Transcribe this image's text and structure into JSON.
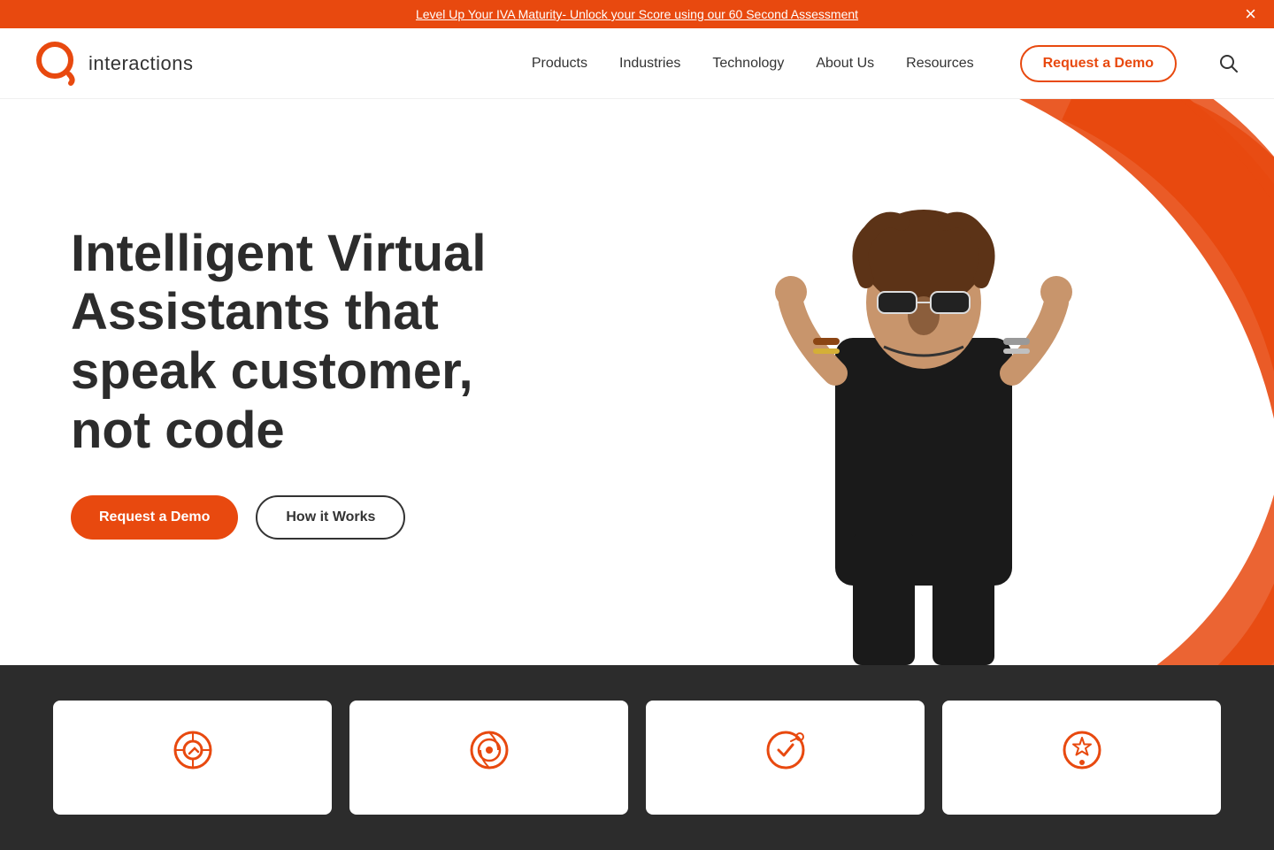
{
  "banner": {
    "text": "Level Up Your IVA Maturity- Unlock your Score using our 60 Second Assessment",
    "link": "Level Up Your IVA Maturity- Unlock your Score using our 60 Second Assessment",
    "close_label": "×"
  },
  "header": {
    "logo_text": "interactions",
    "nav_items": [
      {
        "label": "Products",
        "id": "products"
      },
      {
        "label": "Industries",
        "id": "industries"
      },
      {
        "label": "Technology",
        "id": "technology"
      },
      {
        "label": "About Us",
        "id": "about-us"
      },
      {
        "label": "Resources",
        "id": "resources"
      }
    ],
    "cta_label": "Request a Demo",
    "search_label": "Search"
  },
  "hero": {
    "title": "Intelligent Virtual Assistants that speak customer, not code",
    "cta_primary": "Request a Demo",
    "cta_secondary": "How it Works"
  },
  "cards": [
    {
      "id": "card1",
      "icon": "⊙"
    },
    {
      "id": "card2",
      "icon": "◎"
    },
    {
      "id": "card3",
      "icon": "⊕"
    },
    {
      "id": "card4",
      "icon": "✦"
    }
  ],
  "colors": {
    "orange": "#E8490F",
    "dark": "#2c2c2c",
    "white": "#ffffff"
  }
}
